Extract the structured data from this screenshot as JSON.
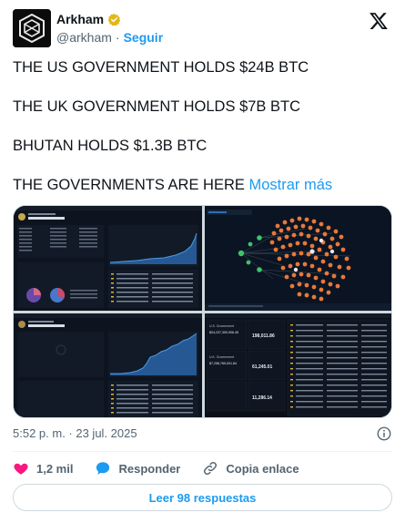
{
  "author": {
    "name": "Arkham",
    "handle": "@arkham",
    "separator": "·",
    "follow_label": "Seguir"
  },
  "post": {
    "line1": "THE US GOVERNMENT HOLDS $24B BTC",
    "line2": "THE UK GOVERNMENT HOLDS $7B BTC",
    "line3": "BHUTAN HOLDS $1.3B BTC",
    "line4": "THE GOVERNMENTS ARE HERE",
    "show_more": "Mostrar más"
  },
  "media": {
    "panel1": {
      "title": "U.S. Government",
      "value": "$24,237,390,906.45"
    },
    "panel3": {
      "value": "$7,258,769,001.84"
    },
    "panel4": {
      "row1_label": "U.S. Government",
      "row1_value": "$24,237,390,906.45",
      "row1_stat": "198,011.86",
      "row2_label": "U.K. Government",
      "row2_value": "$7,258,769,001.84",
      "row2_stat": "61,245.01",
      "row3_stat": "11,286.14"
    }
  },
  "meta": {
    "timestamp": "5:52 p. m. · 23 jul. 2025"
  },
  "actions": {
    "likes": "1,2 mil",
    "reply": "Responder",
    "copy_link": "Copia enlace"
  },
  "footer": {
    "read_replies": "Leer 98 respuestas"
  },
  "colors": {
    "accent": "#1d9bf0",
    "like": "#f91880",
    "verified": "#e2b719",
    "panel_bg": "#0d1420",
    "node_orange": "#e8783a"
  }
}
